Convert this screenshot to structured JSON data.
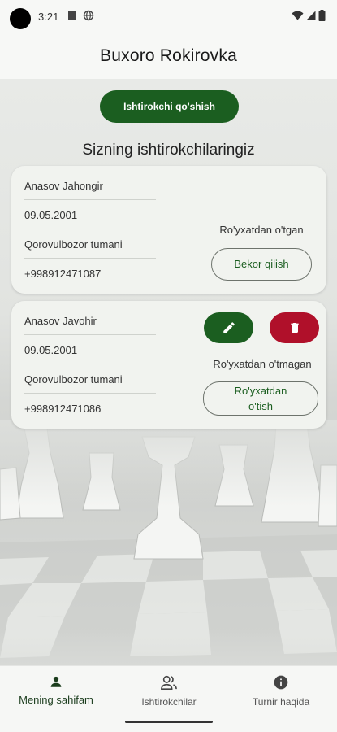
{
  "status_bar": {
    "time": "3:21"
  },
  "app_bar": {
    "title": "Buxoro Rokirovka"
  },
  "main": {
    "add_button": "Ishtirokchi qo'shish",
    "section_title": "Sizning ishtirokchilaringiz",
    "participants": [
      {
        "name": "Anasov Jahongir",
        "birth_date": "09.05.2001",
        "district": "Qorovulbozor tumani",
        "phone": "+998912471087",
        "status": "Ro'yxatdan o'tgan",
        "action": "Bekor qilish"
      },
      {
        "name": "Anasov Javohir",
        "birth_date": "09.05.2001",
        "district": "Qorovulbozor tumani",
        "phone": "+998912471086",
        "status": "Ro'yxatdan o'tmagan",
        "action": "Ro'yxatdan o'tish"
      }
    ]
  },
  "bottom_nav": {
    "items": [
      {
        "label": "Mening sahifam",
        "icon": "person-icon",
        "active": true
      },
      {
        "label": "Ishtirokchilar",
        "icon": "people-icon",
        "active": false
      },
      {
        "label": "Turnir haqida",
        "icon": "info-icon",
        "active": false
      }
    ]
  },
  "colors": {
    "primary": "#1b5e20",
    "danger": "#b0102a"
  }
}
